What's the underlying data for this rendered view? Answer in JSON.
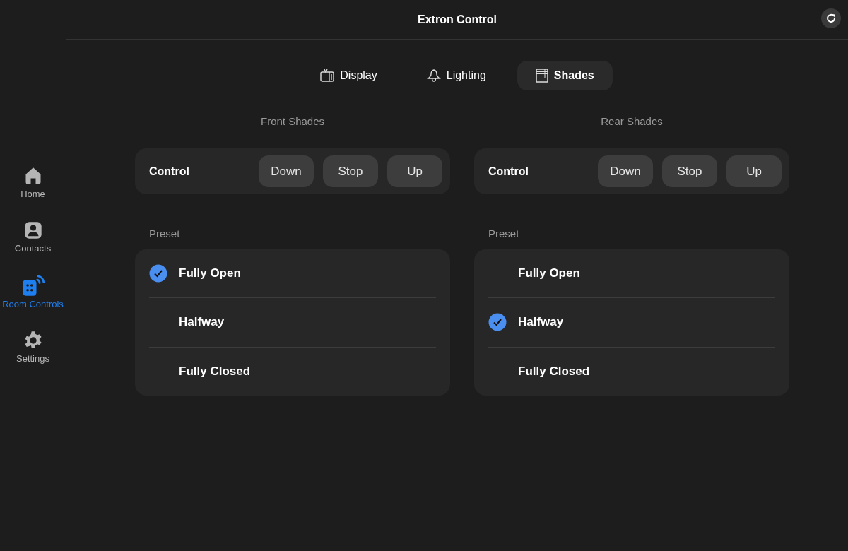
{
  "header": {
    "title": "Extron Control"
  },
  "sidebar": {
    "items": [
      {
        "kind": "home",
        "label": "Home",
        "selected": false
      },
      {
        "kind": "contacts",
        "label": "Contacts",
        "selected": false
      },
      {
        "kind": "room",
        "label": "Room Controls",
        "selected": true
      },
      {
        "kind": "settings",
        "label": "Settings",
        "selected": false
      }
    ]
  },
  "tabs": [
    {
      "kind": "display",
      "label": "Display",
      "selected": false
    },
    {
      "kind": "lighting",
      "label": "Lighting",
      "selected": false
    },
    {
      "kind": "shades",
      "label": "Shades",
      "selected": true
    }
  ],
  "panels": [
    {
      "title": "Front Shades",
      "control": {
        "label": "Control",
        "buttons": [
          "Down",
          "Stop",
          "Up"
        ]
      },
      "preset_label": "Preset",
      "presets": [
        {
          "label": "Fully Open",
          "selected": true
        },
        {
          "label": "Halfway",
          "selected": false
        },
        {
          "label": "Fully Closed",
          "selected": false
        }
      ]
    },
    {
      "title": "Rear Shades",
      "control": {
        "label": "Control",
        "buttons": [
          "Down",
          "Stop",
          "Up"
        ]
      },
      "preset_label": "Preset",
      "presets": [
        {
          "label": "Fully Open",
          "selected": false
        },
        {
          "label": "Halfway",
          "selected": true
        },
        {
          "label": "Fully Closed",
          "selected": false
        }
      ]
    }
  ]
}
